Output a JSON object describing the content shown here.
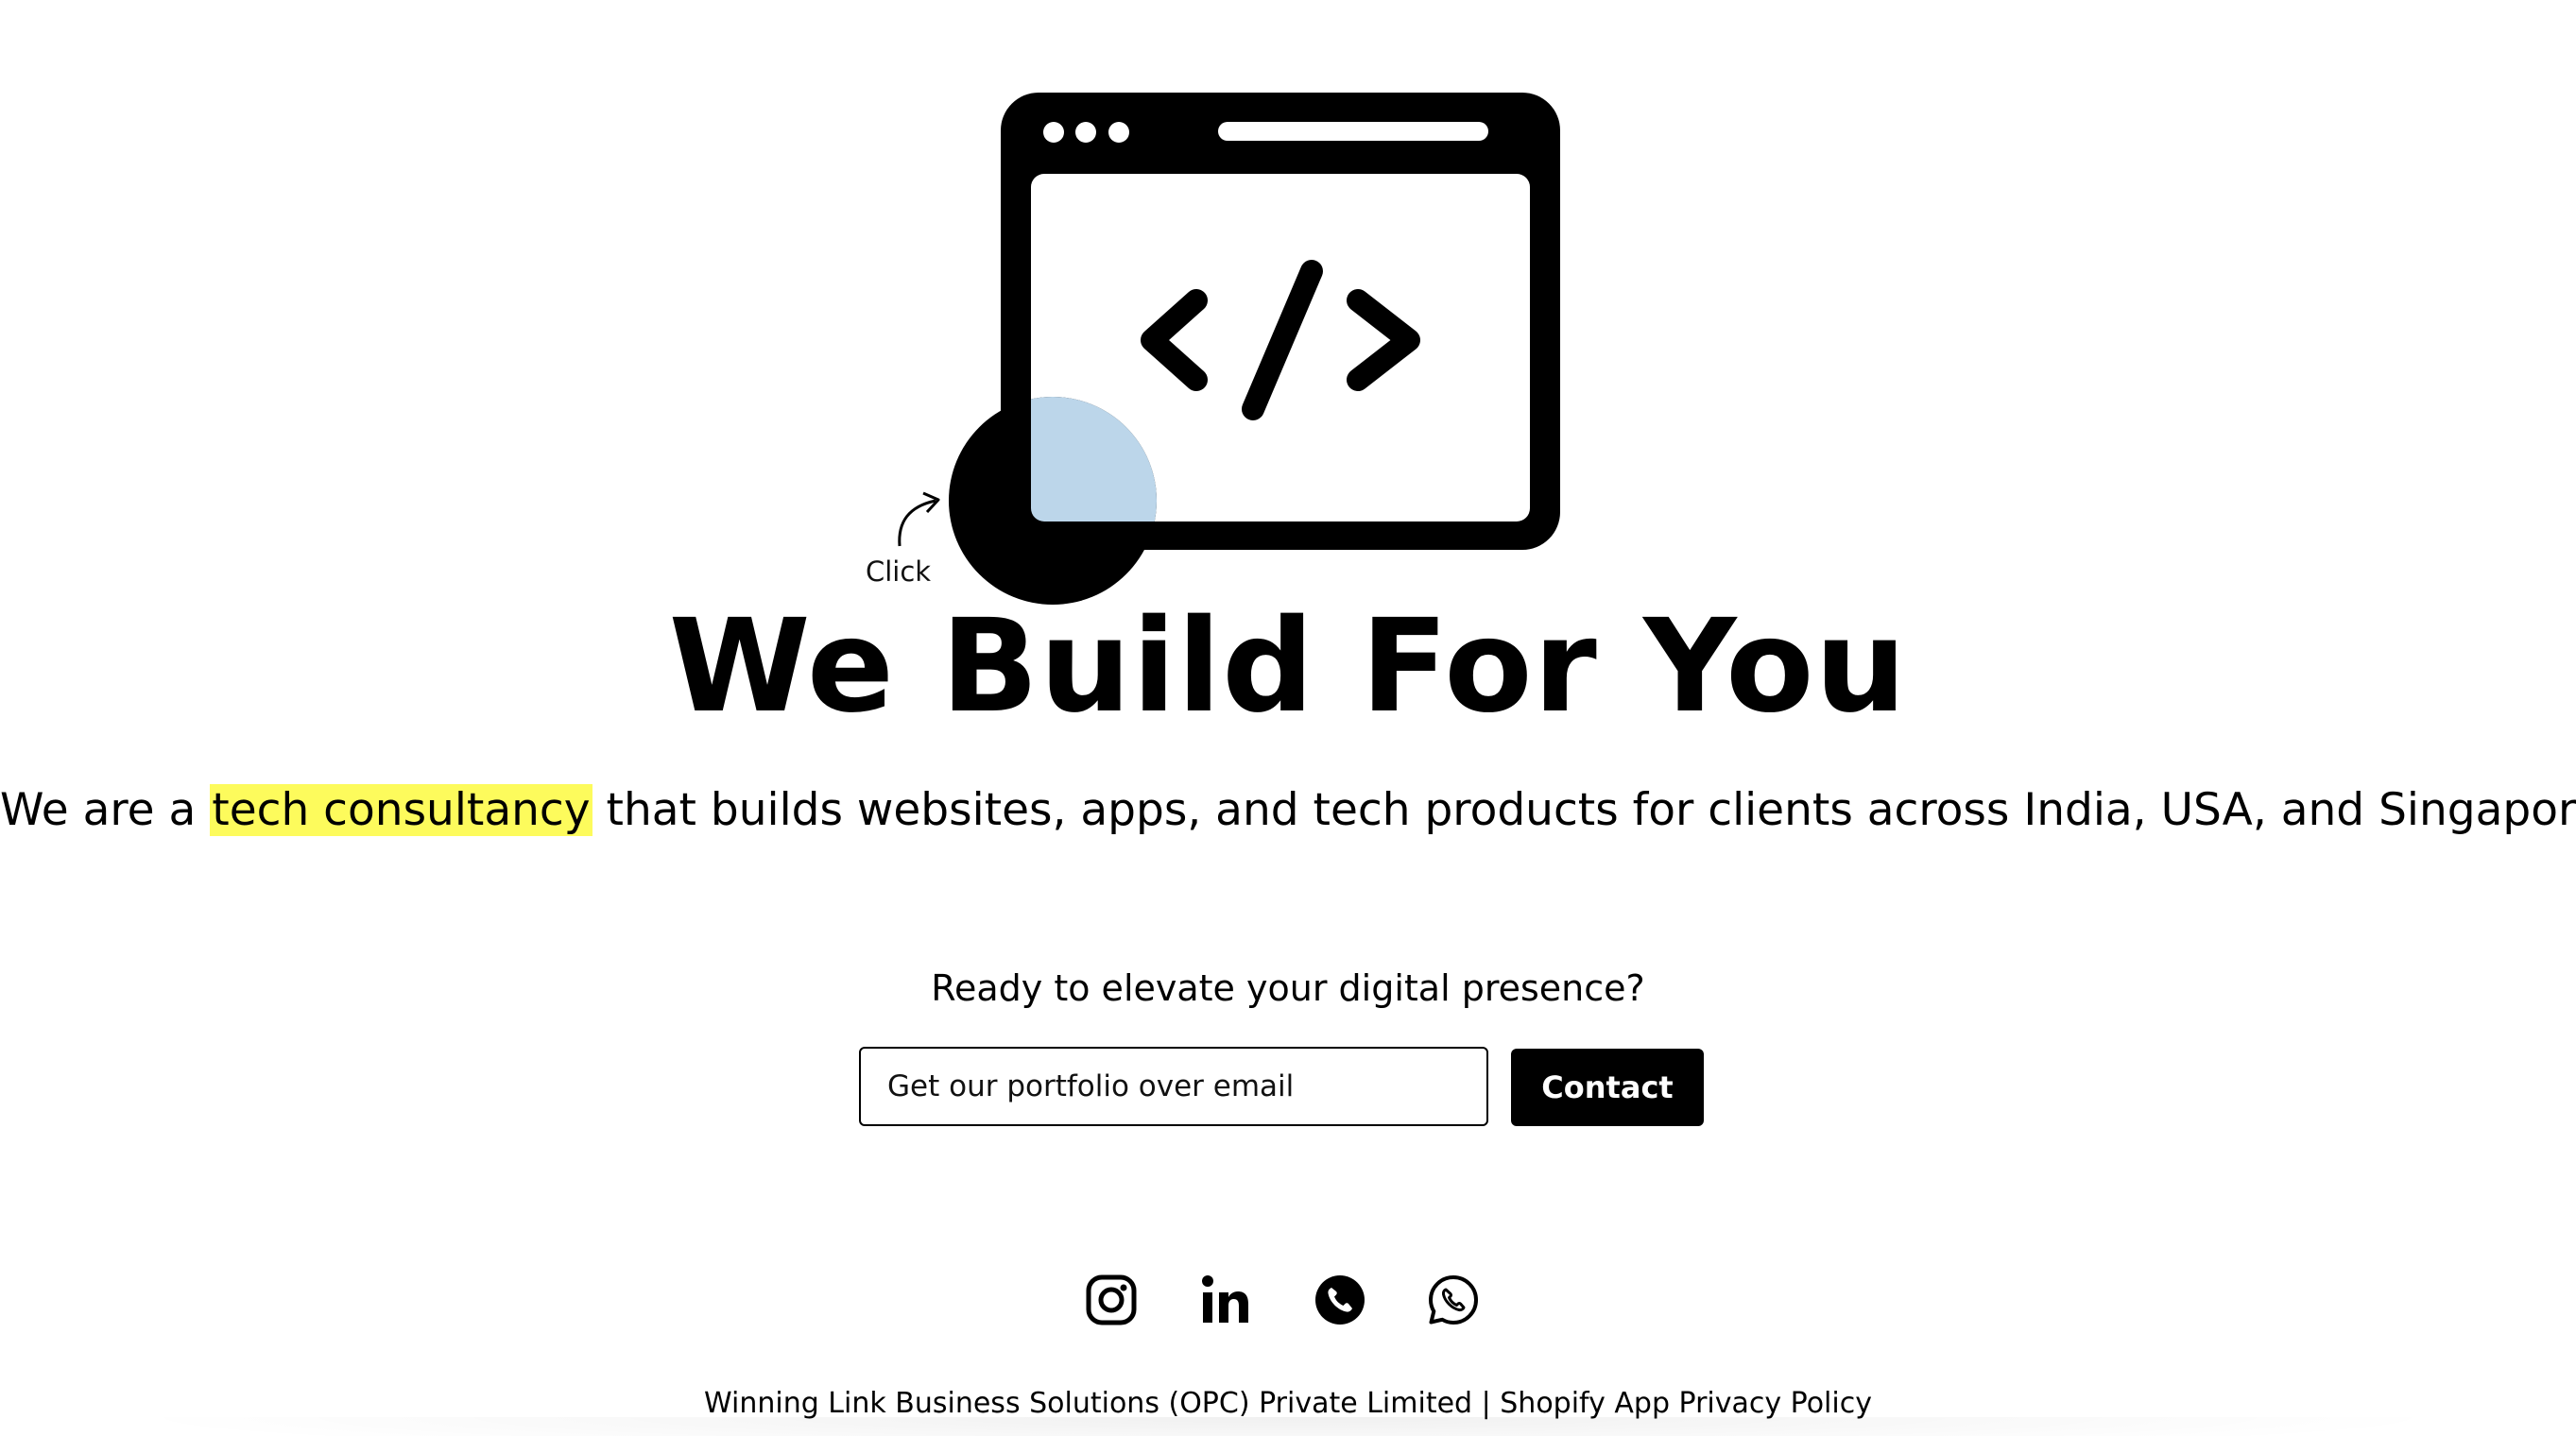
{
  "hero": {
    "click_label": "Click",
    "headline": "We Build For You",
    "subheadline_before": "We are a ",
    "subheadline_highlight": "tech consultancy",
    "subheadline_after": " that builds websites, apps, and tech products for clients across India, USA, and Singapore.",
    "highlight_color": "#fdfb5c",
    "illustration_icon": "browser-code-icon",
    "overlay_color": "#bcd6ea"
  },
  "cta": {
    "question": "Ready to elevate your digital presence?",
    "email_placeholder": "Get our portfolio over email",
    "button_label": "Contact"
  },
  "social": {
    "icons": [
      "instagram-icon",
      "linkedin-icon",
      "phone-icon",
      "whatsapp-icon"
    ]
  },
  "footer": {
    "company": "Winning Link Business Solutions (OPC) Private Limited",
    "separator": " | ",
    "policy_link": "Shopify App Privacy Policy"
  }
}
